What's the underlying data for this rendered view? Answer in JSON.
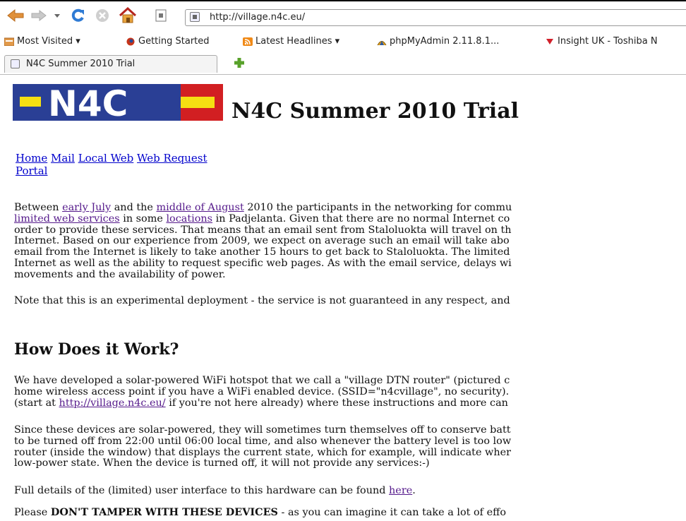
{
  "browser": {
    "url": "http://village.n4c.eu/",
    "bookmarks": [
      "Most Visited ▾",
      "Getting Started",
      "Latest Headlines ▾",
      "phpMyAdmin 2.11.8.1...",
      "Insight UK - Toshiba N"
    ],
    "tab_title": "N4C Summer 2010 Trial",
    "icons": {
      "back": "back-arrow-icon",
      "forward": "forward-arrow-icon",
      "history": "history-dropdown-icon",
      "reload": "reload-icon",
      "stop": "stop-icon",
      "home": "home-icon",
      "new_tab": "plus-icon"
    }
  },
  "logo": {
    "text": "N4C",
    "colors": {
      "blue": "#2a3f95",
      "red": "#d21f22",
      "yellow": "#f5df12"
    }
  },
  "page_title": "N4C Summer 2010 Trial",
  "nav_links": [
    "Home",
    "Mail",
    "Local Web",
    "Web Request Portal"
  ],
  "intro": {
    "l1_a": "Between ",
    "l1_link1": "early July",
    "l1_b": " and the ",
    "l1_link2": "middle of August",
    "l1_c": " 2010 the participants in the networking for commu",
    "l2_link1": "limited web services",
    "l2_a": " in some ",
    "l2_link2": "locations",
    "l2_b": " in Padjelanta. Given that there are no normal Internet co",
    "l3": "order to provide these services. That means that an email sent from Staloluokta will travel on th",
    "l4": "Internet. Based on our experience from 2009, we expect on average such an email will take abo",
    "l5": "email from the Internet is likely to take another 15 hours to get back to Staloluokta. The limited",
    "l6": "Internet as well as the ability to request specific web pages. As with the email service, delays wi",
    "l7": "movements and the availability of power."
  },
  "note": "Note that this is an experimental deployment - the service is not guaranteed in any respect, and",
  "how_heading": "How Does it Work?",
  "how_p1": {
    "l1": "We have developed a solar-powered WiFi hotspot that we call a \"village DTN router\" (pictured c",
    "l2": "home wireless access point if you have a WiFi enabled device. (SSID=\"n4cvillage\", no security).",
    "l3_a": "(start at ",
    "l3_link": "http://village.n4c.eu/",
    "l3_b": " if you're not here already) where these instructions and more can"
  },
  "how_p2": {
    "l1": "Since these devices are solar-powered, they will sometimes turn themselves off to conserve batt",
    "l2": "to be turned off from 22:00 until 06:00 local time, and also whenever the battery level is too low",
    "l3": "router (inside the window) that displays the current state, which for example, will indicate wher",
    "l4": "low-power state. When the device is turned off, it will not provide any services:-)"
  },
  "how_p3": {
    "a": "Full details of the (limited) user interface to this hardware can be found ",
    "link": "here",
    "b": "."
  },
  "how_p4": {
    "a": "Please ",
    "bold": "DON'T TAMPER WITH THESE DEVICES",
    "b": " - as you can imagine it can take a lot of effo"
  }
}
